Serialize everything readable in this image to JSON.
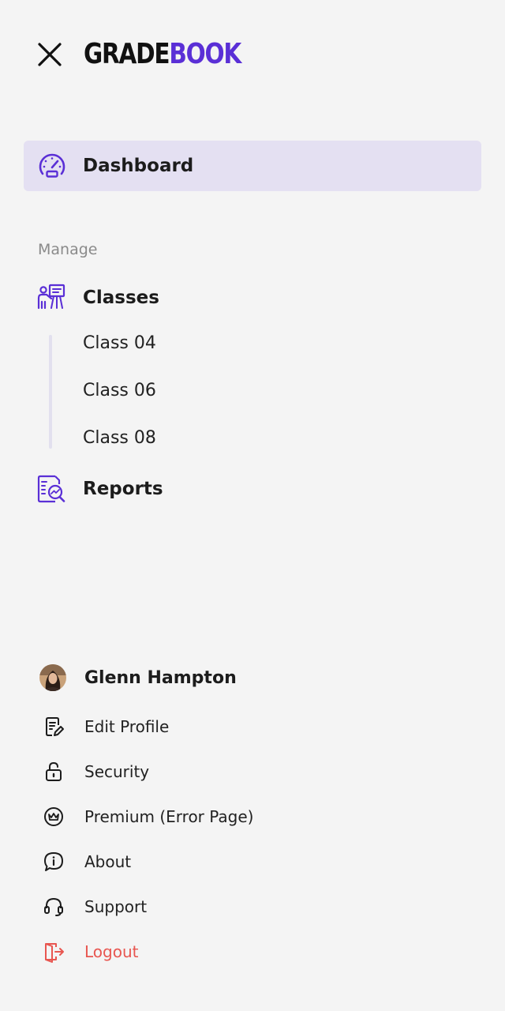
{
  "brand": {
    "part1": "GRADE",
    "part2": "BOOK",
    "accent": "#5a2fd6"
  },
  "header": {
    "close_icon": "close-icon"
  },
  "nav": {
    "dashboard": {
      "label": "Dashboard",
      "icon": "speedometer-icon",
      "active": true,
      "active_bg": "#e4e0f2"
    },
    "section_title": "Manage",
    "classes": {
      "label": "Classes",
      "icon": "presentation-icon",
      "children": [
        "Class 04",
        "Class 06",
        "Class 08"
      ]
    },
    "reports": {
      "label": "Reports",
      "icon": "report-search-icon"
    }
  },
  "user": {
    "name": "Glenn Hampton",
    "menu": [
      {
        "label": "Edit Profile",
        "icon": "edit-document-icon"
      },
      {
        "label": "Security",
        "icon": "lock-icon"
      },
      {
        "label": "Premium (Error Page)",
        "icon": "crown-icon"
      },
      {
        "label": "About",
        "icon": "info-chat-icon"
      },
      {
        "label": "Support",
        "icon": "headset-icon"
      },
      {
        "label": "Logout",
        "icon": "logout-icon",
        "color": "#e85650"
      }
    ]
  }
}
